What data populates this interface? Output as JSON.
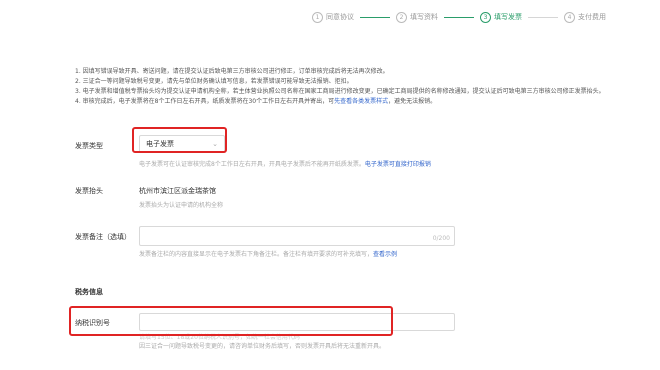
{
  "steps": [
    {
      "num": "1",
      "label": "同意协议"
    },
    {
      "num": "2",
      "label": "填写资料"
    },
    {
      "num": "3",
      "label": "填写发票"
    },
    {
      "num": "4",
      "label": "支付费用"
    }
  ],
  "notice": {
    "line1": "1. 因填写错误导致开具、寄送问题，请在提交认证后致电第三方审核公司进行修正，订单审核完成后将无法再次修改。",
    "line2": "2. 三证合一等问题导致税号变更，请先与单位财务确认填写信息，若发票错误可能导致无法报销、拒扣。",
    "line3": "3. 电子发票和增值税专票抬头均为提交认证申请机构全称，若主体营业执照公司名称在国家工商局进行修改变更，已确定工商局提供的名称修改通知，提交认证后可致电第三方审核公司修正发票抬头。",
    "line4_a": "4. 审核完成后，电子发票将在8个工作日左右开具，纸质发票将在30个工作日左右开具并寄出，可",
    "line4_link": "先查看各类发票样式",
    "line4_b": "，避免无法报销。"
  },
  "invoice_type": {
    "label": "发票类型",
    "value": "电子发票",
    "hint_a": "电子发票可在认证审核完成8个工作日左右开具，开具电子发票后不能再开纸质发票。",
    "hint_link": "电子发票可直接打印报销"
  },
  "invoice_title": {
    "label": "发票抬头",
    "value": "杭州市滨江区派金瑞茶馆",
    "hint": "发票抬头为认证申请的机构全称"
  },
  "invoice_remark": {
    "label": "发票备注（选填）",
    "counter": "0/200",
    "hint_a": "发票备注栏的内容直接显示在电子发票右下角备注栏。备注栏有填开要求的可补充填写，",
    "hint_link": "查看示例"
  },
  "tax_section": {
    "title": "税务信息"
  },
  "tax_id": {
    "label": "纳税识别号",
    "hint1": "请填写15位、18或20位纳税人识别号，如统一社会信用代码",
    "hint2": "因三证合一问题导致税号变更的，请咨询单位财务后填写，否则发票开具后将无法重新开具。"
  }
}
